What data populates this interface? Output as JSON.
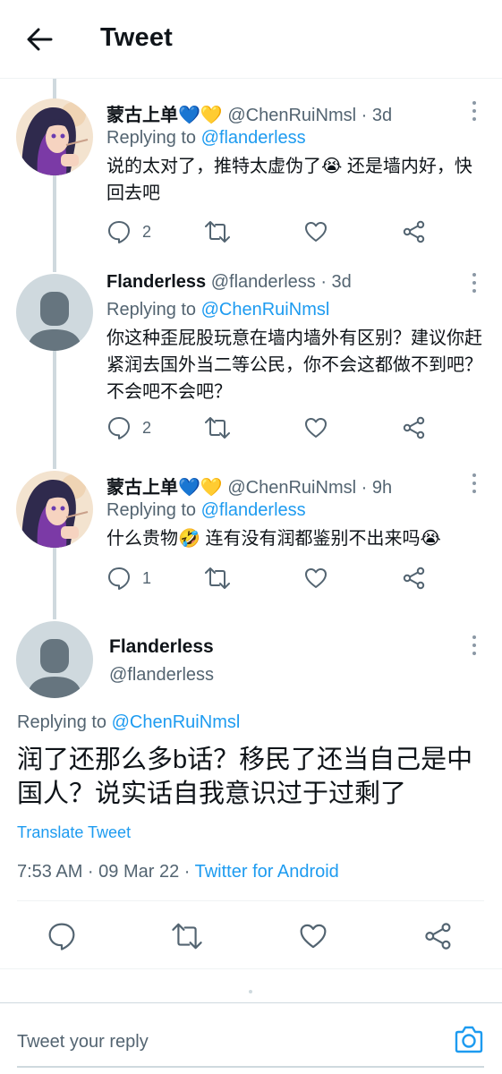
{
  "header": {
    "title": "Tweet"
  },
  "thread": [
    {
      "name": "蒙古上单💙💛",
      "handle_meta": "@ChenRuiNmsl · 3d",
      "replying_prefix": "Replying to",
      "replying_to": "@flanderless",
      "lines": [
        "说的太对了，推特太虚伪了😭 还是墙内好，快",
        "回去吧"
      ],
      "reply_count": "2",
      "retweet_count": "",
      "like_count": ""
    },
    {
      "name": "Flanderless",
      "handle_meta": "@flanderless · 3d",
      "replying_prefix": "Replying to",
      "replying_to": "@ChenRuiNmsl",
      "lines": [
        "你这种歪屁股玩意在墙内墙外有区别？建议你赶",
        "紧润去国外当二等公民，你不会这都做不到吧？",
        "不会吧不会吧？"
      ],
      "reply_count": "2",
      "retweet_count": "",
      "like_count": ""
    },
    {
      "name": "蒙古上单💙💛",
      "handle_meta": "@ChenRuiNmsl · 9h",
      "replying_prefix": "Replying to",
      "replying_to": "@flanderless",
      "lines": [
        "什么贵物🤣 连有没有润都鉴别不出来吗😭"
      ],
      "reply_count": "1",
      "retweet_count": "",
      "like_count": ""
    }
  ],
  "main_tweet": {
    "name": "Flanderless",
    "handle": "@flanderless",
    "replying_prefix": "Replying to",
    "replying_to": "@ChenRuiNmsl",
    "lines": [
      "润了还那么多b话？移民了还当自己是中",
      "国人？说实话自我意识过于过剩了"
    ],
    "translate_label": "Translate Tweet",
    "time_date": "7:53 AM · 09 Mar 22 · ",
    "source": "Twitter for Android"
  },
  "reply_bar": {
    "placeholder": "Tweet your reply"
  },
  "icons": {
    "back": "arrow-left-icon",
    "reply": "speech-bubble-icon",
    "retweet": "retweet-icon",
    "like": "heart-icon",
    "share": "share-icon",
    "more": "more-vertical-icon",
    "camera": "camera-icon"
  },
  "colors": {
    "accent": "#1d9bf0",
    "text_primary": "#0f1419",
    "text_secondary": "#536471",
    "thread_line": "#cfd9de"
  }
}
